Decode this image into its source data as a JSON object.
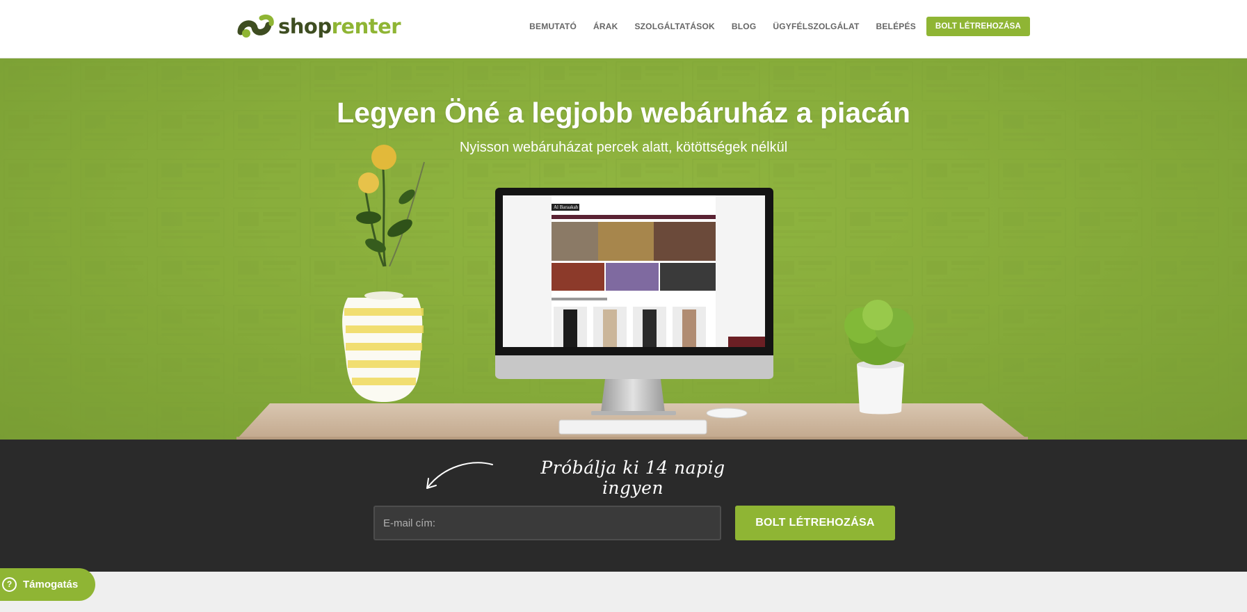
{
  "header": {
    "logo": {
      "part1": "shop",
      "part2": "renter"
    },
    "nav": [
      {
        "label": "BEMUTATÓ"
      },
      {
        "label": "ÁRAK"
      },
      {
        "label": "SZOLGÁLTATÁSOK"
      },
      {
        "label": "BLOG"
      },
      {
        "label": "ÜGYFÉLSZOLGÁLAT"
      },
      {
        "label": "BELÉPÉS"
      }
    ],
    "cta_label": "BOLT LÉTREHOZÁSA"
  },
  "hero": {
    "title": "Legyen Öné a legjobb webáruház a piacán",
    "subtitle": "Nyisson webáruházat percek alatt, kötöttségek nélkül",
    "screen": {
      "brand": "Al Baraakah"
    }
  },
  "signup": {
    "tagline": "Próbálja ki 14 napig ingyen",
    "email_placeholder": "E-mail cím:",
    "submit_label": "BOLT LÉTREHOZÁSA"
  },
  "support": {
    "label": "Támogatás",
    "icon": "question-icon"
  },
  "colors": {
    "accent": "#8fb534",
    "dark_band": "#2a2a2a",
    "logo_dark": "#3e4d21"
  }
}
